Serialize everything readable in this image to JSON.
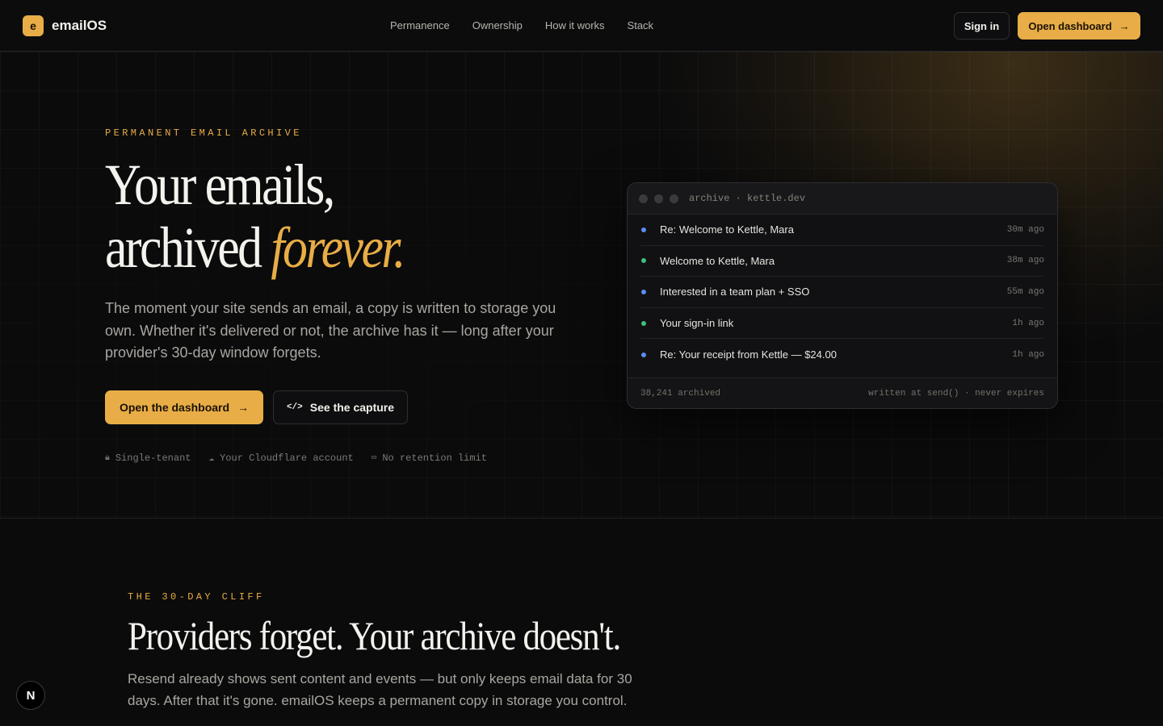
{
  "header": {
    "logo_mark": "e",
    "brand": "emailOS",
    "nav": [
      "Permanence",
      "Ownership",
      "How it works",
      "Stack"
    ],
    "signin_label": "Sign in",
    "dashboard_label": "Open dashboard",
    "dashboard_arrow": "→"
  },
  "hero": {
    "eyebrow": "PERMANENT EMAIL ARCHIVE",
    "title_line1": "Your emails,",
    "title_line2_plain": "archived",
    "title_line2_accent": "forever.",
    "subtitle": "The moment your site sends an email, a copy is written to storage you own. Whether it's delivered or not, the archive has it — long after your provider's 30-day window forgets.",
    "primary_label": "Open the dashboard",
    "primary_arrow": "→",
    "secondary_icon": "</>",
    "secondary_label": "See the capture",
    "badges": [
      {
        "icon": "lock-icon",
        "glyph": "🔒︎",
        "label": "Single-tenant"
      },
      {
        "icon": "cloud-icon",
        "glyph": "☁︎",
        "label": "Your Cloudflare account"
      },
      {
        "icon": "infinity-icon",
        "glyph": "∞",
        "label": "No retention limit"
      }
    ]
  },
  "archive_window": {
    "title": "archive · kettle.dev",
    "rows": [
      {
        "subject": "Re: Welcome to Kettle, Mara",
        "time": "30m ago",
        "status_color": "#5b8def"
      },
      {
        "subject": "Welcome to Kettle, Mara",
        "time": "38m ago",
        "status_color": "#3fbf7f"
      },
      {
        "subject": "Interested in a team plan + SSO",
        "time": "55m ago",
        "status_color": "#5b8def"
      },
      {
        "subject": "Your sign-in link",
        "time": "1h ago",
        "status_color": "#3fbf7f"
      },
      {
        "subject": "Re: Your receipt from Kettle — $24.00",
        "time": "1h ago",
        "status_color": "#5b8def"
      }
    ],
    "footer_left": "38,241 archived",
    "footer_right": "written at send() · never expires"
  },
  "section2": {
    "eyebrow": "THE 30-DAY CLIFF",
    "title": "Providers forget. Your archive doesn't.",
    "subtitle": "Resend already shows sent content and events — but only keeps email data for 30 days. After that it's gone. emailOS keeps a permanent copy in storage you control."
  },
  "dev_badge": "N",
  "colors": {
    "accent": "#e8ad46",
    "background": "#0b0b0c"
  }
}
